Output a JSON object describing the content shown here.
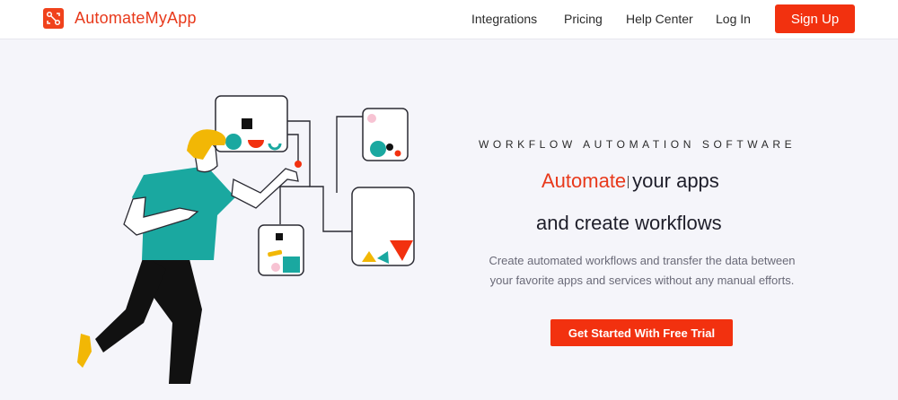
{
  "header": {
    "brand_name": "AutomateMyApp",
    "nav": {
      "integrations": "Integrations",
      "pricing": "Pricing",
      "help_center": "Help Center",
      "login": "Log In",
      "signup": "Sign Up"
    }
  },
  "hero": {
    "eyebrow": "WORKFLOW AUTOMATION SOFTWARE",
    "headline_accent": "Automate",
    "headline_rest": "your apps",
    "headline_line2": "and create workflows",
    "description_line1": "Create automated workflows and transfer the data between",
    "description_line2": "your favorite apps and services without any manual efforts.",
    "cta": "Get Started With Free Trial"
  },
  "colors": {
    "brand": "#f2310f",
    "teal": "#1aa8a0",
    "yellow": "#f2b705",
    "background": "#f5f5fa"
  },
  "icons": {
    "logo": "workflow-nodes-logo-icon"
  }
}
